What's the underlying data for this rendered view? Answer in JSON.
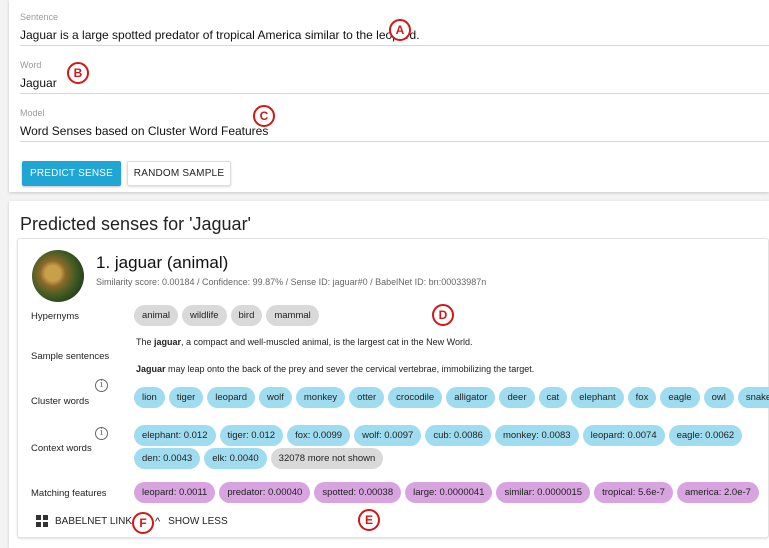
{
  "form": {
    "sentence": {
      "label": "Sentence",
      "value": "Jaguar is a large spotted predator of tropical America similar to the leopard."
    },
    "word": {
      "label": "Word",
      "value": "Jaguar"
    },
    "model": {
      "label": "Model",
      "value": "Word Senses based on Cluster Word Features"
    },
    "buttons": {
      "predict": "PREDICT SENSE",
      "random": "RANDOM SAMPLE"
    }
  },
  "results": {
    "title": "Predicted senses for 'Jaguar'",
    "sense": {
      "name": "1. jaguar (animal)",
      "meta": "Similarity score: 0.00184 / Confidence: 99.87% / Sense ID: jaguar#0 / BabelNet ID: bn:00033987n",
      "labels": {
        "hypernyms": "Hypernyms",
        "samples": "Sample sentences",
        "cluster": "Cluster words",
        "context": "Context words",
        "matching": "Matching features"
      },
      "hypernyms": [
        "animal",
        "wildlife",
        "bird",
        "mammal"
      ],
      "samples": [
        {
          "pre": "The ",
          "bold": "jaguar",
          "post": ", a compact and well-muscled animal, is the largest cat in the New World."
        },
        {
          "pre": "",
          "bold": "Jaguar",
          "post": " may leap onto the back of the prey and sever the cervical vertebrae, immobilizing the target."
        }
      ],
      "cluster_words": [
        "lion",
        "tiger",
        "leopard",
        "wolf",
        "monkey",
        "otter",
        "crocodile",
        "alligator",
        "deer",
        "cat",
        "elephant",
        "fox",
        "eagle",
        "owl",
        "snake"
      ],
      "context_words_row1": [
        "elephant: 0.012",
        "tiger: 0.012",
        "fox: 0.0099",
        "wolf: 0.0097",
        "cub: 0.0086",
        "monkey: 0.0083",
        "leopard: 0.0074",
        "eagle: 0.0062"
      ],
      "context_words_row2": [
        "den: 0.0043",
        "elk: 0.0040"
      ],
      "context_more": "32078 more not shown",
      "matching_features": [
        "leopard: 0.0011",
        "predator: 0.00040",
        "spotted: 0.00038",
        "large: 0.0000041",
        "similar: 0.0000015",
        "tropical: 5.6e-7",
        "america: 2.0e-7"
      ],
      "footer": {
        "babelnet": "BABELNET LINK",
        "show_less": "SHOW LESS"
      }
    }
  },
  "markers": [
    "A",
    "B",
    "C",
    "D",
    "E",
    "F"
  ],
  "colors": {
    "primary": "#1fa6d4",
    "chip_gray": "#d9d9d9",
    "chip_blue": "#9fdcef",
    "chip_purple": "#d8a4e0",
    "marker": "#d01818"
  },
  "icons": {
    "info": "info-icon",
    "babelnet": "babelnet-logo-icon",
    "chevron": "chevron-up-icon"
  }
}
